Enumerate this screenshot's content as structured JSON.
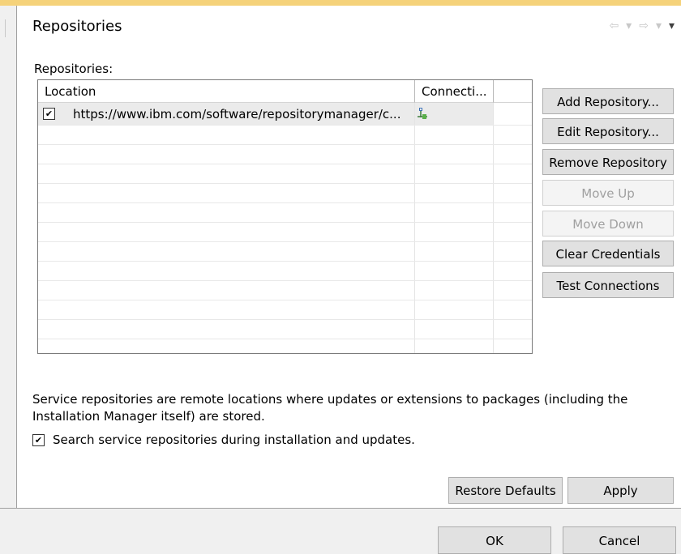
{
  "page": {
    "title": "Repositories",
    "section_label": "Repositories:"
  },
  "history_nav": {
    "back_icon": "⇦",
    "dropdown_icon": "▾",
    "forward_icon": "⇨",
    "menu_icon": "▾"
  },
  "table": {
    "columns": [
      "Location",
      "Connecti...",
      ""
    ],
    "rows": [
      {
        "checked": true,
        "location": "https://www.ibm.com/software/repositorymanager/c...",
        "connection_icon": "network-connection-icon"
      }
    ]
  },
  "buttons": {
    "add": "Add Repository...",
    "edit": "Edit Repository...",
    "remove": "Remove Repository",
    "move_up": "Move Up",
    "move_down": "Move Down",
    "clear": "Clear Credentials",
    "test": "Test Connections",
    "restore": "Restore Defaults",
    "apply": "Apply",
    "ok": "OK",
    "cancel": "Cancel"
  },
  "description": "Service repositories are remote locations where updates or extensions to packages (including the Installation Manager itself) are stored.",
  "search_option": {
    "label": "Search service repositories during installation and updates.",
    "checked": true
  },
  "colors": {
    "accent_bar": "#f5d27a",
    "pane_background": "#ffffff",
    "dialog_background": "#f0f0f0"
  }
}
